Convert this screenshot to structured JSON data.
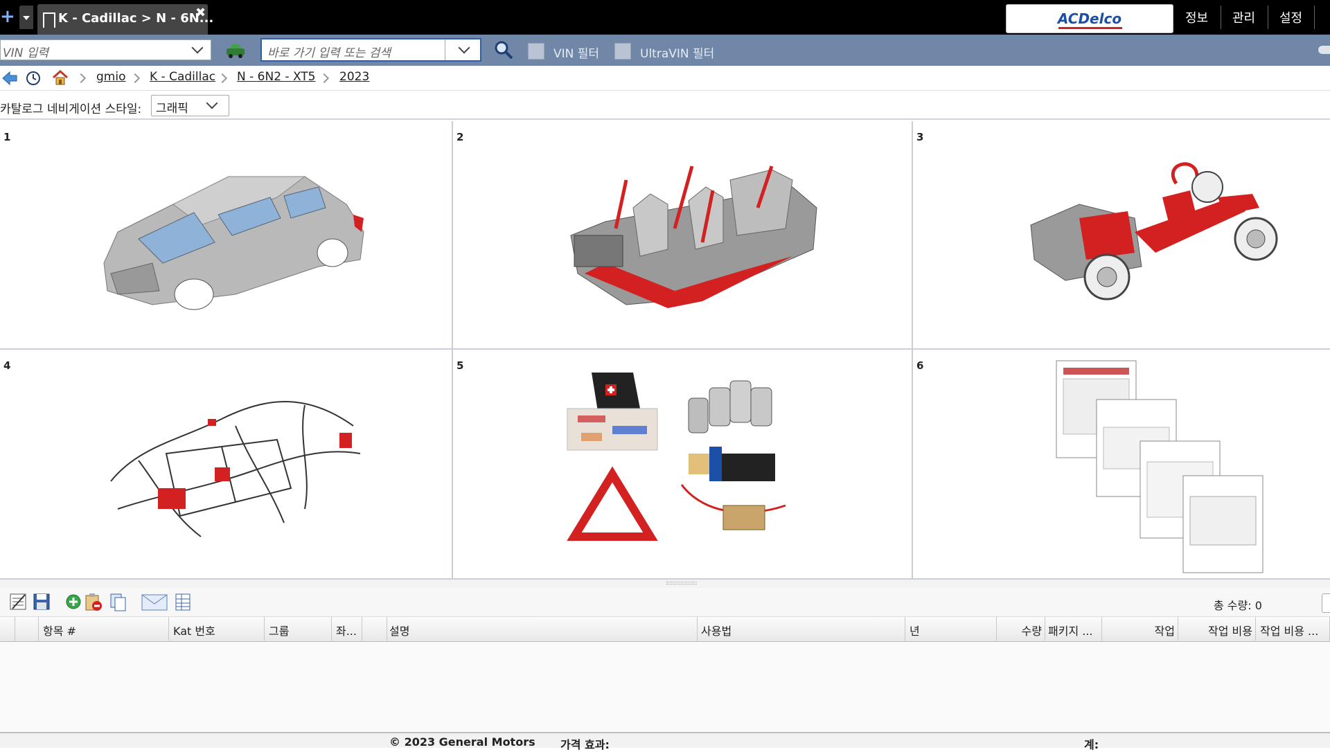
{
  "tab": {
    "title": "K - Cadillac > N - 6N...",
    "close": "✖"
  },
  "brand": {
    "logo_text": "ACDelco",
    "logo_color": "#1b4fa8",
    "accent": "#d32020"
  },
  "topmenu": {
    "info": "정보",
    "manage": "관리",
    "settings": "설정"
  },
  "toolbar": {
    "vin_placeholder": "VIN 입력",
    "search_placeholder": "바로 가기 입력 또는 검색",
    "vin_filter": "VIN 필터",
    "ultravin_filter": "UltraVIN 필터"
  },
  "breadcrumb": [
    "gmio",
    "K - Cadillac",
    "N - 6N2 - XT5",
    "2023"
  ],
  "navstyle": {
    "label": "카탈로그 네비게이션 스타일:",
    "value": "그래픽"
  },
  "tiles": [
    {
      "num": "1",
      "icon": "vehicle-body-icon"
    },
    {
      "num": "2",
      "icon": "interior-seats-icon"
    },
    {
      "num": "3",
      "icon": "chassis-drivetrain-icon"
    },
    {
      "num": "4",
      "icon": "wiring-harness-icon"
    },
    {
      "num": "5",
      "icon": "accessories-icon"
    },
    {
      "num": "6",
      "icon": "documents-icon"
    }
  ],
  "bottom": {
    "total": "총 수량: 0"
  },
  "columns": [
    "항목 #",
    "Kat 번호",
    "그룹",
    "좌...",
    "설명",
    "사용법",
    "년",
    "수량",
    "패키지 ...",
    "작업",
    "작업 비용",
    "작업 비용 ..."
  ],
  "footer": {
    "copyright": "© 2023 General Motors",
    "price": "가격 효과:",
    "total": "계:"
  }
}
